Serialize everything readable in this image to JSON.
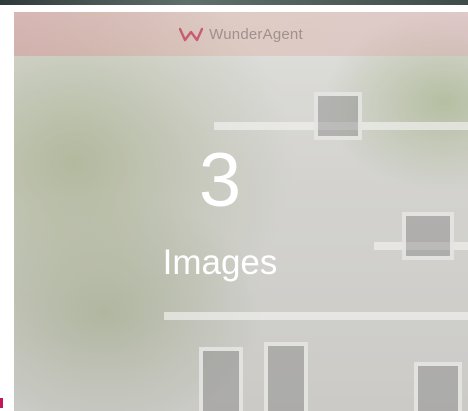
{
  "header": {
    "brand_name": "WunderAgent",
    "logo_icon": "wunderagent-logo-icon",
    "accent": "#c23a56"
  },
  "gallery": {
    "count": "3",
    "label": "Images"
  }
}
